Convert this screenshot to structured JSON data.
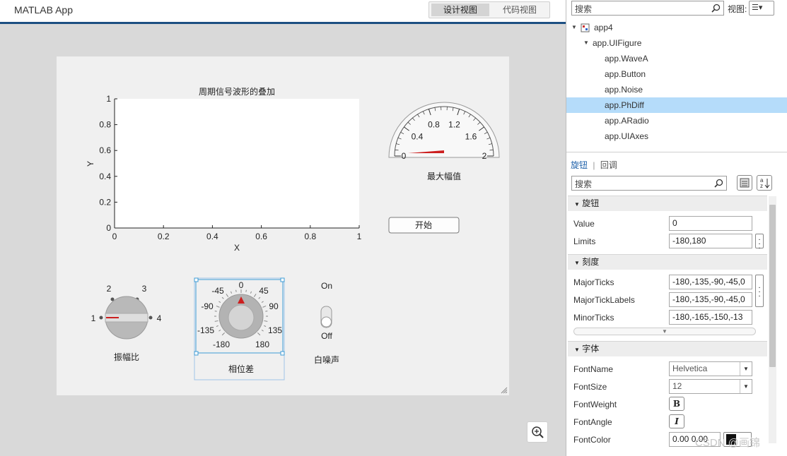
{
  "app": {
    "title": "MATLAB App"
  },
  "view_tabs": [
    {
      "label": "设计视图",
      "active": true
    },
    {
      "label": "代码视图",
      "active": false
    }
  ],
  "canvas": {
    "axes": {
      "title": "周期信号波形的叠加",
      "xlabel": "X",
      "ylabel": "Y",
      "xticks": [
        "0",
        "0.2",
        "0.4",
        "0.6",
        "0.8",
        "1"
      ],
      "yticks": [
        "0",
        "0.2",
        "0.4",
        "0.6",
        "0.8",
        "1"
      ]
    },
    "gauge": {
      "label": "最大幅值",
      "ticks": [
        "0",
        "0.4",
        "0.8",
        "1.2",
        "1.6",
        "2"
      ],
      "min": 0,
      "max": 2,
      "value": 0
    },
    "start_button": "开始",
    "amp_knob": {
      "label": "振幅比",
      "positions": [
        "1",
        "2",
        "3",
        "4"
      ],
      "value": 1
    },
    "phase_knob": {
      "label": "相位差",
      "ticks": [
        "-180",
        "-135",
        "-90",
        "-45",
        "0",
        "45",
        "90",
        "135",
        "180"
      ],
      "value": 0
    },
    "noise_switch": {
      "label": "白噪声",
      "on": "On",
      "off": "Off",
      "state": "Off"
    }
  },
  "inspector": {
    "search_placeholder": "搜索",
    "view_label": "视图:",
    "tree": [
      {
        "label": "app4",
        "level": 0,
        "expanded": true
      },
      {
        "label": "app.UIFigure",
        "level": 1,
        "expanded": true
      },
      {
        "label": "app.WaveA",
        "level": 2
      },
      {
        "label": "app.Button",
        "level": 2
      },
      {
        "label": "app.Noise",
        "level": 2
      },
      {
        "label": "app.PhDiff",
        "level": 2,
        "selected": true
      },
      {
        "label": "app.ARadio",
        "level": 2
      },
      {
        "label": "app.UIAxes",
        "level": 2
      }
    ],
    "subtabs": [
      {
        "label": "旋钮",
        "active": true
      },
      {
        "label": "回调",
        "active": false
      }
    ],
    "prop_search_placeholder": "搜索",
    "sections": {
      "knob": "旋钮",
      "ticks": "刻度",
      "font": "字体"
    },
    "props": {
      "value": {
        "label": "Value",
        "val": "0"
      },
      "limits": {
        "label": "Limits",
        "val": "-180,180"
      },
      "major_ticks": {
        "label": "MajorTicks",
        "val": "-180,-135,-90,-45,0"
      },
      "major_tick_labels": {
        "label": "MajorTickLabels",
        "val": "-180,-135,-90,-45,0"
      },
      "minor_ticks": {
        "label": "MinorTicks",
        "val": "-180,-165,-150,-13"
      },
      "font_name": {
        "label": "FontName",
        "val": "Helvetica"
      },
      "font_size": {
        "label": "FontSize",
        "val": "12"
      },
      "font_weight": {
        "label": "FontWeight",
        "btn": "B"
      },
      "font_angle": {
        "label": "FontAngle",
        "btn": "I"
      },
      "font_color": {
        "label": "FontColor",
        "val": "0.00 0.00"
      }
    }
  },
  "watermark": "CSDN @画锦",
  "colors": {
    "accent": "#1c4f82",
    "selected": "#b5dcfa",
    "needle": "#cc1f1f"
  }
}
